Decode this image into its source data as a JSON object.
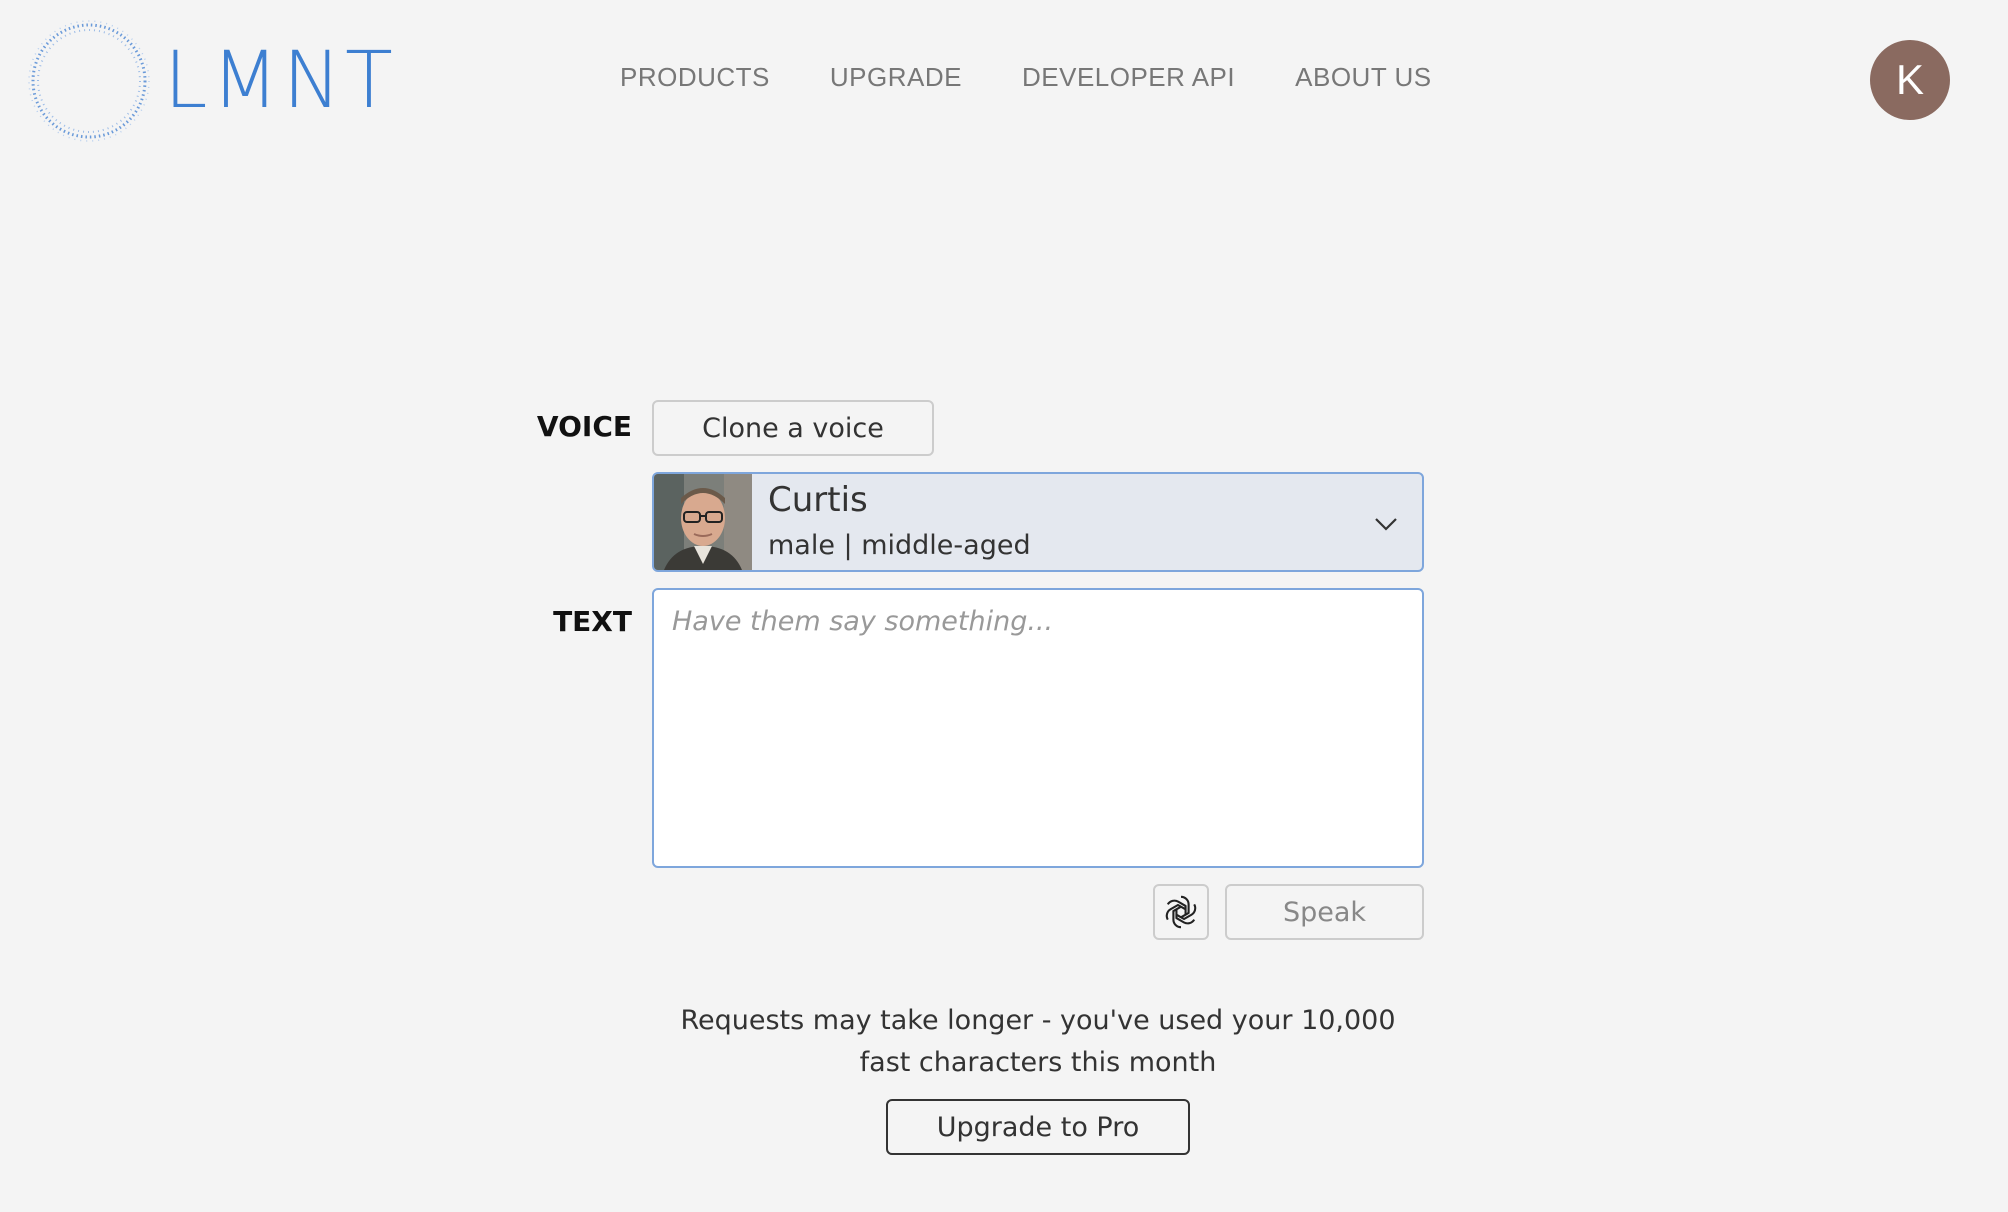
{
  "header": {
    "logo_text": "LMNT",
    "nav": [
      "PRODUCTS",
      "UPGRADE",
      "DEVELOPER API",
      "ABOUT US"
    ],
    "avatar_initial": "K"
  },
  "form": {
    "voice_label": "VOICE",
    "clone_button": "Clone a voice",
    "selected_voice": {
      "name": "Curtis",
      "description": "male | middle-aged"
    },
    "text_label": "TEXT",
    "text_placeholder": "Have them say something...",
    "text_value": "",
    "speak_button": "Speak"
  },
  "notice": "Requests may take longer - you've used your 10,000 fast characters this month",
  "upgrade_button": "Upgrade to Pro",
  "colors": {
    "background": "#f4f4f4",
    "brand": "#3d7fd1",
    "avatar": "#8a6a60",
    "select_bg": "#e4e8ef",
    "focus_border": "#7ea6dc"
  },
  "icons": {
    "chevron": "chevron-down-icon",
    "gpt": "openai-icon"
  }
}
